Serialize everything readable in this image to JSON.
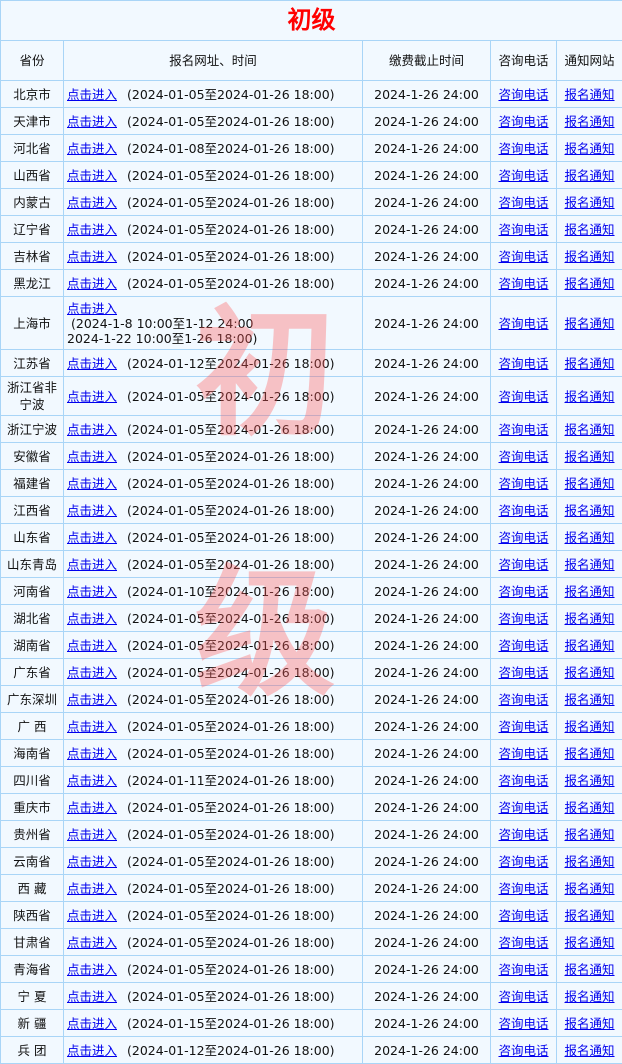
{
  "title": "初级",
  "headers": [
    "省份",
    "报名网址、时间",
    "缴费截止时间",
    "咨询电话",
    "通知网站"
  ],
  "link_label": "点击进入",
  "phone_label": "咨询电话",
  "notice_label": "报名通知",
  "deadline": "2024-1-26 24:00",
  "watermark": [
    "初",
    "级"
  ],
  "rows": [
    {
      "p": "北京市",
      "t": "(2024-01-05至2024-01-26 18:00)"
    },
    {
      "p": "天津市",
      "t": "(2024-01-05至2024-01-26 18:00)"
    },
    {
      "p": "河北省",
      "t": "(2024-01-08至2024-01-26 18:00)"
    },
    {
      "p": "山西省",
      "t": "(2024-01-05至2024-01-26 18:00)"
    },
    {
      "p": "内蒙古",
      "t": "(2024-01-05至2024-01-26 18:00)"
    },
    {
      "p": "辽宁省",
      "t": "(2024-01-05至2024-01-26 18:00)"
    },
    {
      "p": "吉林省",
      "t": "(2024-01-05至2024-01-26 18:00)"
    },
    {
      "p": "黑龙江",
      "t": "(2024-01-05至2024-01-26 18:00)"
    },
    {
      "p": "上海市",
      "t": "(2024-1-8 10:00至1-12 24:00",
      "t2": "2024-1-22 10:00至1-26 18:00)",
      "multi": true
    },
    {
      "p": "江苏省",
      "t": "(2024-01-12至2024-01-26 18:00)"
    },
    {
      "p": "浙江省非宁波",
      "t": "(2024-01-05至2024-01-26 18:00)"
    },
    {
      "p": "浙江宁波",
      "t": "(2024-01-05至2024-01-26 18:00)"
    },
    {
      "p": "安徽省",
      "t": "(2024-01-05至2024-01-26 18:00)"
    },
    {
      "p": "福建省",
      "t": "(2024-01-05至2024-01-26 18:00)"
    },
    {
      "p": "江西省",
      "t": "(2024-01-05至2024-01-26 18:00)"
    },
    {
      "p": "山东省",
      "t": "(2024-01-05至2024-01-26 18:00)"
    },
    {
      "p": "山东青岛",
      "t": "(2024-01-05至2024-01-26 18:00)"
    },
    {
      "p": "河南省",
      "t": "(2024-01-10至2024-01-26 18:00)"
    },
    {
      "p": "湖北省",
      "t": "(2024-01-05至2024-01-26 18:00)"
    },
    {
      "p": "湖南省",
      "t": "(2024-01-05至2024-01-26 18:00)"
    },
    {
      "p": "广东省",
      "t": "(2024-01-05至2024-01-26 18:00)"
    },
    {
      "p": "广东深圳",
      "t": "(2024-01-05至2024-01-26 18:00)"
    },
    {
      "p": "广 西",
      "t": "(2024-01-05至2024-01-26 18:00)"
    },
    {
      "p": "海南省",
      "t": "(2024-01-05至2024-01-26 18:00)"
    },
    {
      "p": "四川省",
      "t": "(2024-01-11至2024-01-26 18:00)"
    },
    {
      "p": "重庆市",
      "t": "(2024-01-05至2024-01-26 18:00)"
    },
    {
      "p": "贵州省",
      "t": "(2024-01-05至2024-01-26 18:00)"
    },
    {
      "p": "云南省",
      "t": "(2024-01-05至2024-01-26 18:00)"
    },
    {
      "p": "西 藏",
      "t": "(2024-01-05至2024-01-26 18:00)"
    },
    {
      "p": "陕西省",
      "t": "(2024-01-05至2024-01-26 18:00)"
    },
    {
      "p": "甘肃省",
      "t": "(2024-01-05至2024-01-26 18:00)"
    },
    {
      "p": "青海省",
      "t": "(2024-01-05至2024-01-26 18:00)"
    },
    {
      "p": "宁 夏",
      "t": "(2024-01-05至2024-01-26 18:00)"
    },
    {
      "p": "新 疆",
      "t": "(2024-01-15至2024-01-26 18:00)"
    },
    {
      "p": "兵 团",
      "t": "(2024-01-12至2024-01-26 18:00)"
    }
  ]
}
